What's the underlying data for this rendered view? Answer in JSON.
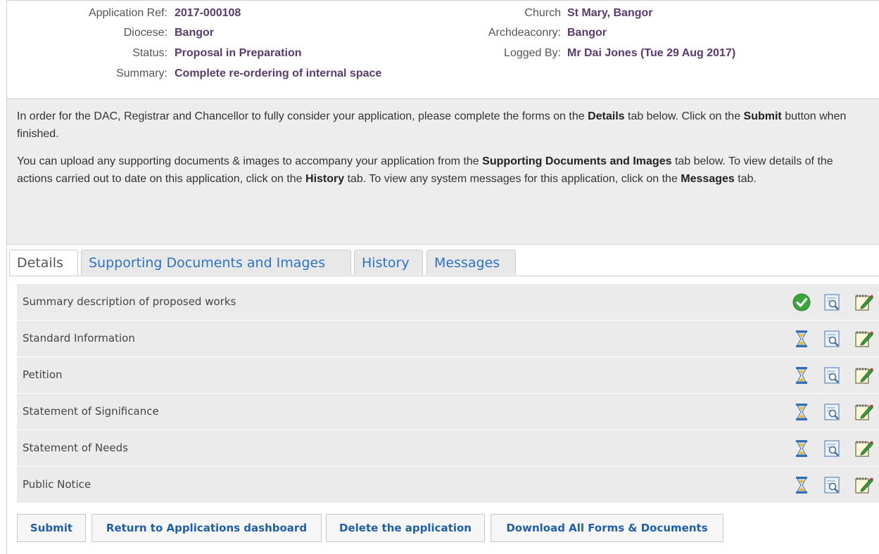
{
  "info": {
    "app_ref_label": "Application Ref:",
    "app_ref_value": "2017-000108",
    "diocese_label": "Diocese:",
    "diocese_value": "Bangor",
    "status_label": "Status:",
    "status_value": "Proposal in Preparation",
    "summary_label": "Summary:",
    "summary_value": "Complete re-ordering of internal space",
    "church_label": "Church",
    "church_value": "St Mary, Bangor",
    "archdeaconry_label": "Archdeaconry:",
    "archdeaconry_value": "Bangor",
    "logged_by_label": "Logged By:",
    "logged_by_value": "Mr Dai Jones (Tue 29 Aug 2017)"
  },
  "notice": {
    "p1_a": "In order for the DAC, Registrar and Chancellor to fully consider your application, please complete the forms on the ",
    "p1_b": "Details",
    "p1_c": " tab below. Click on the ",
    "p1_d": "Submit",
    "p1_e": " button when finished.",
    "p2_a": "You can upload any supporting documents & images to accompany your application from the ",
    "p2_b": "Supporting Documents and Images",
    "p2_c": " tab below. To view details of the actions carried out to date on this application, click on the ",
    "p2_d": "History",
    "p2_e": " tab. To view any system messages for this application, click on the ",
    "p2_f": "Messages",
    "p2_g": " tab."
  },
  "tabs": [
    "Details",
    "Supporting Documents and Images",
    "History",
    "Messages"
  ],
  "rows": [
    {
      "label": "Summary description of proposed works",
      "status_icon": "check-icon"
    },
    {
      "label": "Standard Information",
      "status_icon": "hourglass-icon"
    },
    {
      "label": "Petition",
      "status_icon": "hourglass-icon"
    },
    {
      "label": "Statement of Significance",
      "status_icon": "hourglass-icon"
    },
    {
      "label": "Statement of Needs",
      "status_icon": "hourglass-icon"
    },
    {
      "label": "Public Notice",
      "status_icon": "hourglass-icon"
    }
  ],
  "buttons": {
    "submit": "Submit",
    "return": "Return to Applications dashboard",
    "delete": "Delete the application",
    "download": "Download All Forms & Documents"
  },
  "colors": {
    "value_text": "#5b3a6e",
    "tab_link": "#2a73c4",
    "button_text": "#1f5fa8",
    "row_bg": "#ebebeb",
    "notice_bg": "#ededed"
  }
}
